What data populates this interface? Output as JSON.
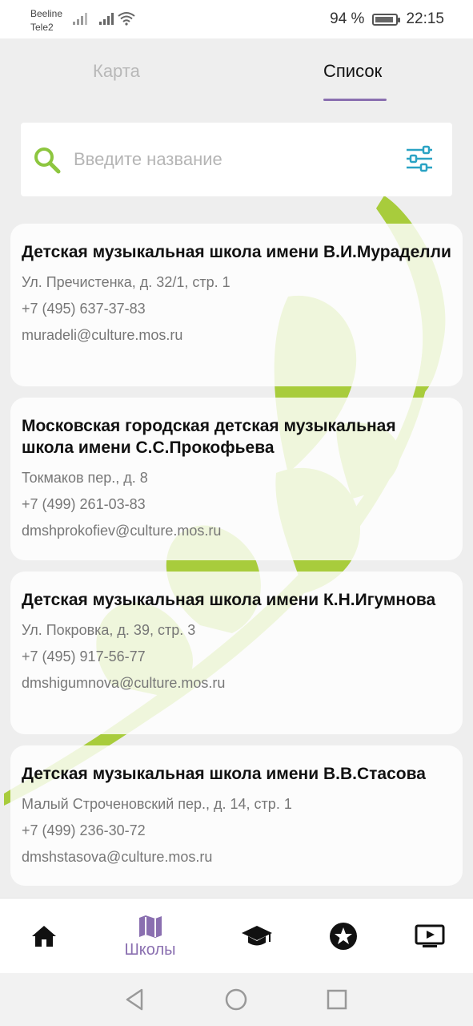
{
  "status_bar": {
    "carrier1": "Beeline",
    "carrier2": "Tele2",
    "battery": "94 %",
    "time": "22:15"
  },
  "tabs": [
    {
      "label": "Карта",
      "active": false
    },
    {
      "label": "Список",
      "active": true
    }
  ],
  "search": {
    "placeholder": "Введите название",
    "value": ""
  },
  "schools": [
    {
      "name": "Детская музыкальная школа имени В.И.Мураделли",
      "address": "Ул. Пречистенка, д. 32/1, стр. 1",
      "phone": "+7 (495) 637-37-83",
      "email": "muradeli@culture.mos.ru"
    },
    {
      "name": "Московская городская детская музыкальная школа имени С.С.Прокофьева",
      "address": "Токмаков пер., д. 8",
      "phone": "+7 (499) 261-03-83",
      "email": "dmshprokofiev@culture.mos.ru"
    },
    {
      "name": "Детская музыкальная школа имени К.Н.Игумнова",
      "address": "Ул. Покровка, д. 39, стр. 3",
      "phone": "+7 (495) 917-56-77",
      "email": "dmshigumnova@culture.mos.ru"
    },
    {
      "name": "Детская музыкальная школа имени В.В.Стасова",
      "address": "Малый Строченовский пер., д. 14, стр. 1",
      "phone": "+7 (499) 236-30-72",
      "email": "dmshstasova@culture.mos.ru"
    }
  ],
  "bottom_nav": {
    "items": [
      {
        "icon": "home-icon",
        "label": ""
      },
      {
        "icon": "map-icon",
        "label": "Школы",
        "active": true
      },
      {
        "icon": "graduation-cap-icon",
        "label": ""
      },
      {
        "icon": "star-circle-icon",
        "label": ""
      },
      {
        "icon": "tv-play-icon",
        "label": ""
      }
    ]
  },
  "colors": {
    "accent": "#8a6fb0",
    "vine": "#a8cc3c",
    "search_icon": "#8dc63f",
    "filter_icon": "#2ba3c4"
  }
}
